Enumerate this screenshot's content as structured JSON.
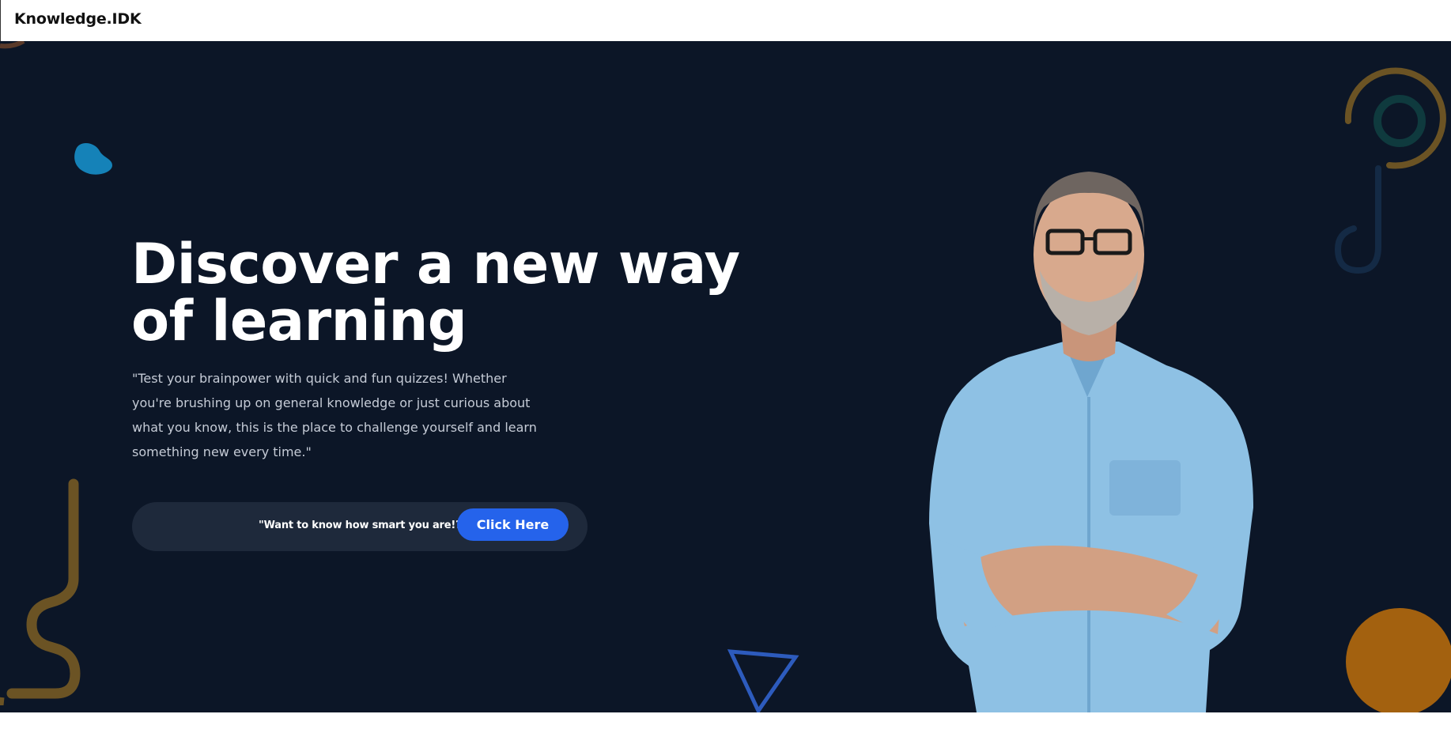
{
  "navbar": {
    "brand": "Knowledge.IDK"
  },
  "hero": {
    "title": "Discover a new way of learning",
    "description": "\"Test your brainpower with quick and fun quizzes! Whether you're brushing up on general knowledge or just curious about what you know, this is the place to challenge yourself and learn something new every time.\"",
    "cta": {
      "prompt": "\"Want to know how smart you are!?\"",
      "button_label": "Click Here"
    }
  },
  "colors": {
    "background": "#0c1627",
    "accent": "#2563eb",
    "cta_bar": "#1e293b",
    "deco_blue_blob": "#1582b8",
    "deco_gold": "#6b5324",
    "deco_orange": "#a3610f",
    "deco_triangle": "#2d5bbd",
    "deco_teal": "#0f3a3e",
    "deco_navy": "#142a45",
    "shirt": "#8ec1e4"
  },
  "icons": {
    "blob": "blue-blob-icon",
    "squiggle": "squiggle-icon",
    "triangle": "triangle-icon",
    "rings": "concentric-rings-icon",
    "hook": "hook-icon",
    "circle": "orange-circle-icon"
  }
}
